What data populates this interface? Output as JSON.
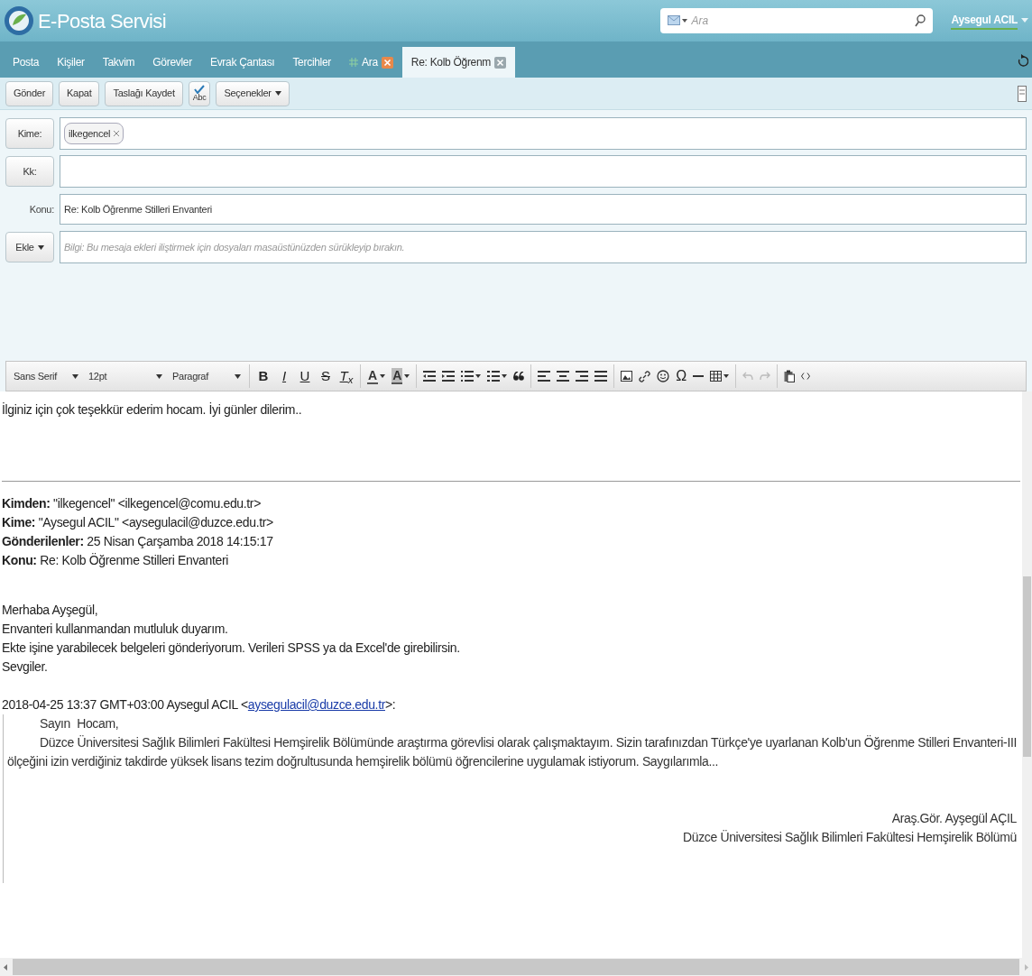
{
  "header": {
    "title": "E-Posta Servisi",
    "search": {
      "placeholder": "Ara"
    },
    "user": "Aysegul ACIL"
  },
  "tabs": [
    {
      "label": "Posta",
      "selected": false,
      "closable": false
    },
    {
      "label": "Kişiler",
      "selected": false,
      "closable": false
    },
    {
      "label": "Takvim",
      "selected": false,
      "closable": false
    },
    {
      "label": "Görevler",
      "selected": false,
      "closable": false
    },
    {
      "label": "Evrak Çantası",
      "selected": false,
      "closable": false
    },
    {
      "label": "Tercihler",
      "selected": false,
      "closable": false
    },
    {
      "label": "Ara",
      "selected": false,
      "closable": true
    },
    {
      "label": "Re: Kolb Öğrenm",
      "selected": true,
      "closable": true
    }
  ],
  "toolbar": {
    "buttons": [
      "Gönder",
      "Kapat",
      "Taslağı Kaydet"
    ],
    "spellcheck": "Abc",
    "options": "Seçenekler"
  },
  "compose": {
    "to": {
      "label": "Kime:",
      "recipients": [
        "ilkegencel"
      ]
    },
    "cc": {
      "label": "Kk:"
    },
    "subject": {
      "label": "Konu:",
      "value": "Re: Kolb Öğrenme Stilleri Envanteri"
    },
    "attach": {
      "label": "Ekle",
      "placeholder": "Bilgi: Bu mesaja ekleri iliştirmek için dosyaları masaüstünüzden sürükleyip bırakın."
    }
  },
  "editor_toolbar": {
    "font": "Sans Serif",
    "size": "12pt",
    "format": "Paragraf",
    "glyphs": [
      "B",
      "I",
      "U",
      "S",
      "T$_{x}$",
      "A",
      "A",
      "Ω"
    ]
  },
  "message": {
    "reply": "İlginiz için çok teşekkür ederim hocam. İyi günler dilerim..",
    "quoted_headers": [
      "**Kimden:** \"ilkegencel\" <ilkegencel@comu.edu.tr>",
      "**Kime:** \"Aysegul ACIL\" <aysegulacil@duzce.edu.tr>",
      "**Gönderilenler:** 25 Nisan Çarşamba 2018 14:15:17",
      "**Konu:** Re: Kolb Öğrenme Stilleri Envanteri"
    ],
    "lines": [
      "Merhaba Ayşegül,",
      "Envanteri kullanmandan mutluluk duyarım.",
      "Ekte işine yarabilecek belgeleri gönderiyorum. Verileri SPSS ya da Excel'de girebilirsin.",
      "Sevgiler."
    ],
    "quote_intro": {
      "before": "2018-04-25 13:37 GMT+03:00 Aysegul ACIL <",
      "link": "aysegulacil@duzce.edu.tr",
      "after": ">:"
    },
    "quoted_body": {
      "greeting": "Sayın  Hocam,",
      "paragraph": "Düzce Üniversitesi Sağlık Bilimleri Fakültesi Hemşirelik Bölümünde araştırma görevlisi olarak çalışmaktayım. Sizin tarafınızdan Türkçe'ye uyarlanan Kolb'un Öğrenme Stilleri Envanteri-III ölçeğini izin verdiğiniz takdirde yüksek lisans tezim doğrultusunda hemşirelik bölümü öğrencilerine uygulamak istiyorum. Saygılarımla...",
      "signature": [
        "Araş.Gör. Ayşegül AÇIL",
        "Düzce Üniversitesi Sağlık Bilimleri Fakültesi Hemşirelik Bölümü"
      ]
    }
  }
}
